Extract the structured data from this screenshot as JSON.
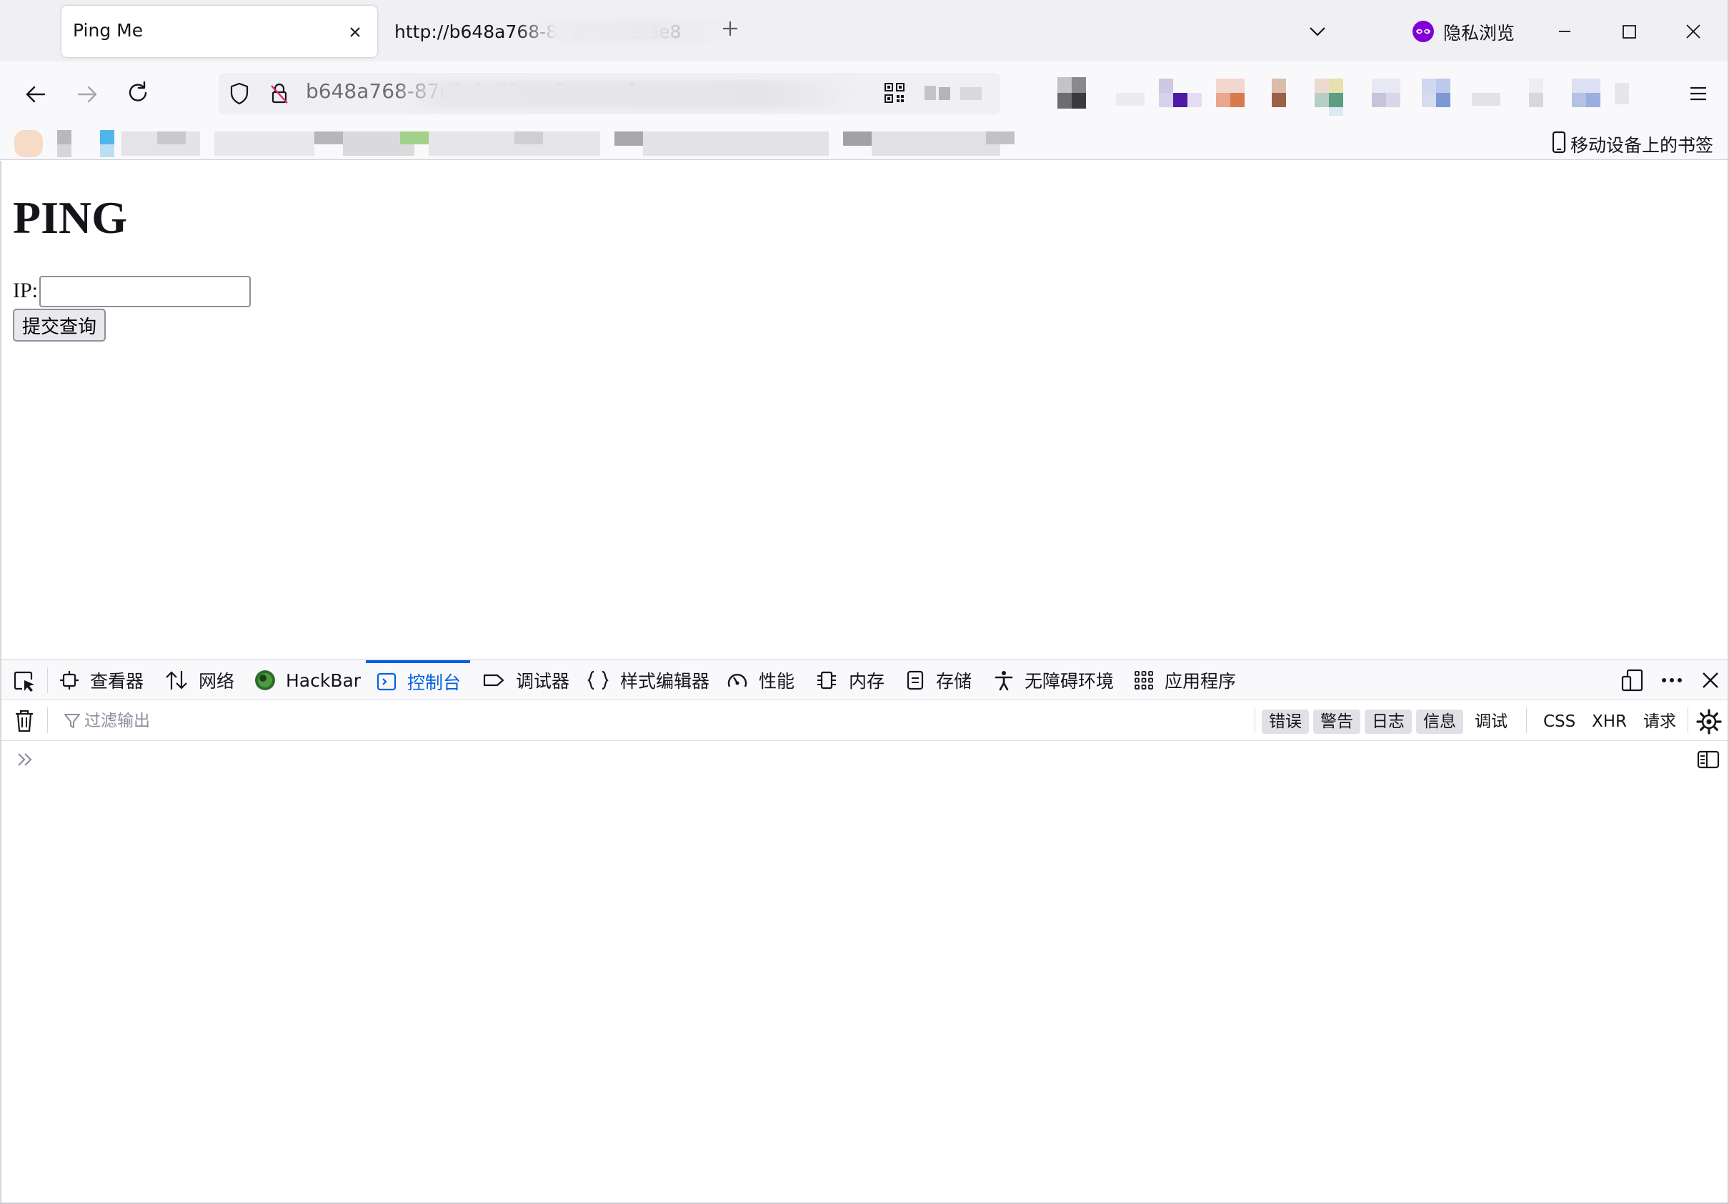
{
  "colors": {
    "tabstrip_bg": "#f0f0f4",
    "navbar_bg": "#f9f9fb",
    "accent_blue": "#0061e0",
    "private_purple": "#8000d7"
  },
  "tabs": [
    {
      "title": "Ping Me",
      "active": true,
      "close_icon": "close-icon"
    },
    {
      "title": "http://b648a768-87c9-4e73-ae8",
      "active": false
    }
  ],
  "tabstrip": {
    "new_tab_icon": "plus-icon",
    "list_tabs_icon": "chevron-down-icon",
    "private_label": "隐私浏览",
    "private_icon": "mask-icon"
  },
  "window_controls": {
    "minimize_icon": "minimize-icon",
    "maximize_icon": "maximize-icon",
    "close_icon": "close-icon"
  },
  "navbar": {
    "back_icon": "arrow-left-icon",
    "forward_icon": "arrow-right-icon",
    "reload_icon": "reload-icon",
    "url": "b648a768-87c9-4e73-ae8.qsnctf.c",
    "shield_icon": "shield-icon",
    "lock_icon": "insecure-lock-icon",
    "qr_icon": "qr-code-icon",
    "menu_icon": "hamburger-icon"
  },
  "bookmarks": {
    "mobile_label": "移动设备上的书签",
    "mobile_icon": "phone-icon"
  },
  "page": {
    "heading": "PING",
    "ip_label": "IP:",
    "ip_value": "",
    "submit_label": "提交查询"
  },
  "devtools": {
    "tabs": [
      {
        "label": "查看器",
        "icon": "inspector-icon"
      },
      {
        "label": "网络",
        "icon": "network-arrows-icon"
      },
      {
        "label": "HackBar",
        "icon": "hackbar-icon"
      },
      {
        "label": "控制台",
        "icon": "console-icon",
        "selected": true
      },
      {
        "label": "调试器",
        "icon": "debugger-icon"
      },
      {
        "label": "样式编辑器",
        "icon": "braces-icon"
      },
      {
        "label": "性能",
        "icon": "gauge-icon"
      },
      {
        "label": "内存",
        "icon": "memory-icon"
      },
      {
        "label": "存储",
        "icon": "storage-icon"
      },
      {
        "label": "无障碍环境",
        "icon": "accessibility-icon"
      },
      {
        "label": "应用程序",
        "icon": "grid-icon"
      }
    ],
    "console": {
      "filter_placeholder": "过滤输出",
      "levels": [
        {
          "label": "错误",
          "on": true
        },
        {
          "label": "警告",
          "on": true
        },
        {
          "label": "日志",
          "on": true
        },
        {
          "label": "信息",
          "on": true
        },
        {
          "label": "调试",
          "on": false
        }
      ],
      "types": [
        "CSS",
        "XHR",
        "请求"
      ]
    }
  }
}
